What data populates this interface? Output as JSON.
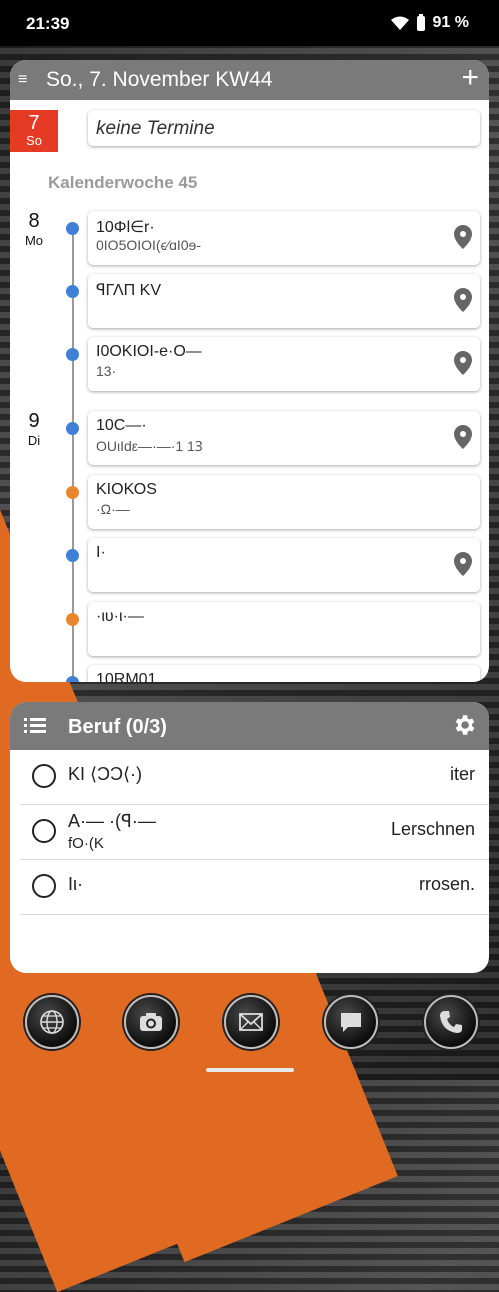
{
  "status": {
    "time": "21:39",
    "battery": "91 %"
  },
  "calendar": {
    "header_title": "So., 7. November KW44",
    "today": {
      "day_num": "7",
      "day_name": "So",
      "text": "keine Termine"
    },
    "week_label": "Kalenderwoche 45",
    "days": [
      {
        "num": "8",
        "name": "Mo"
      },
      {
        "num": "9",
        "name": "Di"
      }
    ],
    "events": [
      {
        "line1": "10Φl∈r·",
        "line2": "0ΙΟ5ΟΙΟΙ(ϵ⁄ɑΙ0ɘ-",
        "color": "#3f7fd6",
        "pin": true
      },
      {
        "line1": "ꟼΓΛΠ ΚV",
        "line2": "",
        "color": "#3f7fd6",
        "pin": true
      },
      {
        "line1": "Ι0ΟΚΙΟΙ-e·Ο—",
        "line2": "13·",
        "color": "#3f7fd6",
        "pin": true
      },
      {
        "line1": "10C—·",
        "line2": "ΟUιΙdε—·—·1 1Ꝫ",
        "color": "#3f7fd6",
        "pin": true
      },
      {
        "line1": "ΚΙΟΚΟS",
        "line2": "·Ω·—",
        "color": "#e8862d",
        "pin": false
      },
      {
        "line1": "Ι·",
        "line2": "",
        "color": "#3f7fd6",
        "pin": true
      },
      {
        "line1": "·ιυ·ι·—",
        "line2": "",
        "color": "#e8862d",
        "pin": false
      },
      {
        "line1": "10RM01",
        "line2": "",
        "color": "#3f7fd6",
        "pin": false
      }
    ]
  },
  "tasks": {
    "title": "Beruf (0/3)",
    "items": [
      {
        "left": "ΚΙ ⟨ϽϽ⟨·)",
        "right": "iter",
        "sub": ""
      },
      {
        "left": "A·— ·(ꟼ·—",
        "right": "Lerschnen",
        "sub": "fΟ·(Κ"
      },
      {
        "left": "Ιι·",
        "right": "rrosen.",
        "sub": ""
      }
    ]
  },
  "dock": [
    {
      "name": "browser",
      "icon": "globe-icon"
    },
    {
      "name": "camera",
      "icon": "camera-icon"
    },
    {
      "name": "email",
      "icon": "envelope-icon"
    },
    {
      "name": "messages",
      "icon": "chat-icon"
    },
    {
      "name": "phone",
      "icon": "phone-icon"
    }
  ]
}
